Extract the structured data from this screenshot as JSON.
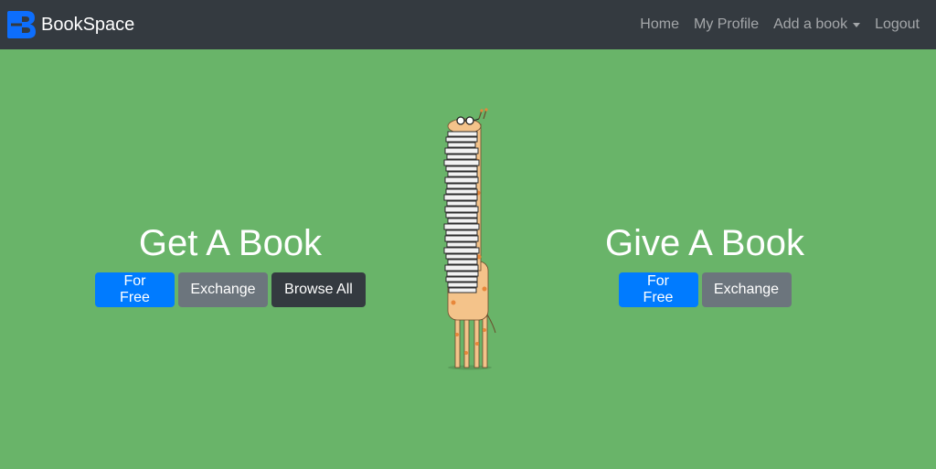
{
  "navbar": {
    "brand": "BookSpace",
    "links": {
      "home": "Home",
      "profile": "My Profile",
      "add_book": "Add a book",
      "logout": "Logout"
    }
  },
  "get_section": {
    "title": "Get A Book",
    "buttons": {
      "free": "For Free",
      "exchange": "Exchange",
      "browse": "Browse All"
    }
  },
  "give_section": {
    "title": "Give A Book",
    "buttons": {
      "free": "For Free",
      "exchange": "Exchange"
    }
  },
  "colors": {
    "background": "#69b469",
    "navbar": "#343a40",
    "primary": "#007bff",
    "secondary": "#6c757d",
    "dark": "#343a40"
  },
  "icons": {
    "logo": "bookspace-logo-icon",
    "illustration": "giraffe-with-books-illustration",
    "dropdown": "chevron-down-icon"
  }
}
